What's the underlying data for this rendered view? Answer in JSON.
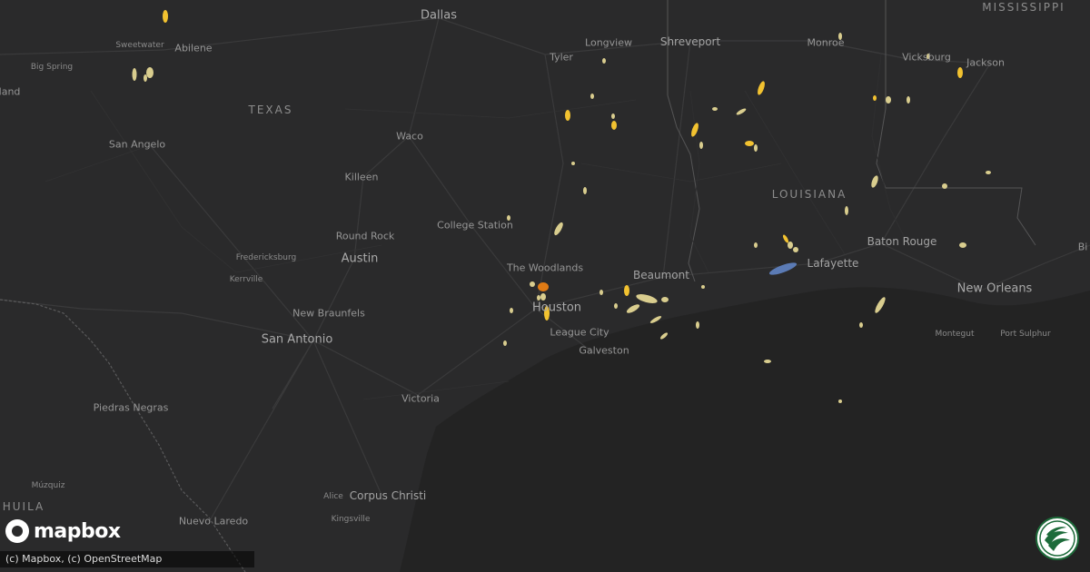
{
  "map": {
    "states": [
      "TEXAS",
      "LOUISIANA",
      "MISSISSIPPI"
    ],
    "cities_large": [
      "Dallas",
      "Houston",
      "Austin",
      "San Antonio",
      "New Orleans",
      "Baton Rouge",
      "Lafayette",
      "Beaumont",
      "Shreveport",
      "Corpus Christi"
    ],
    "cities_medium": [
      "Abilene",
      "San Angelo",
      "Waco",
      "Killeen",
      "College Station",
      "Round Rock",
      "New Braunfels",
      "Victoria",
      "Tyler",
      "Longview",
      "Monroe",
      "Vicksburg",
      "Jackson",
      "The Woodlands",
      "League City",
      "Galveston",
      "Nuevo Laredo",
      "Piedras Negras"
    ],
    "cities_small": [
      "Sweetwater",
      "Big Spring",
      "Fredericksburg",
      "Kerrville",
      "Alice",
      "Kingsville",
      "Montegut",
      "Port Sulphur",
      "Múzquiz"
    ],
    "edge_labels": [
      "lland",
      "Bi",
      "HUILA"
    ]
  },
  "logo": {
    "wordmark": "mapbox",
    "icon": "mapbox-logo-icon"
  },
  "attribution": "(c) Mapbox, (c) OpenStreetMap",
  "brand_icon": "weather-service-logo-icon",
  "colors": {
    "background": "#2a2a2b",
    "gulf": "#232323",
    "hail_light": "#d9cd8e",
    "hail_yellow": "#f2c230",
    "hail_orange": "#e07b15",
    "wind_blue": "#5b7bb5"
  }
}
